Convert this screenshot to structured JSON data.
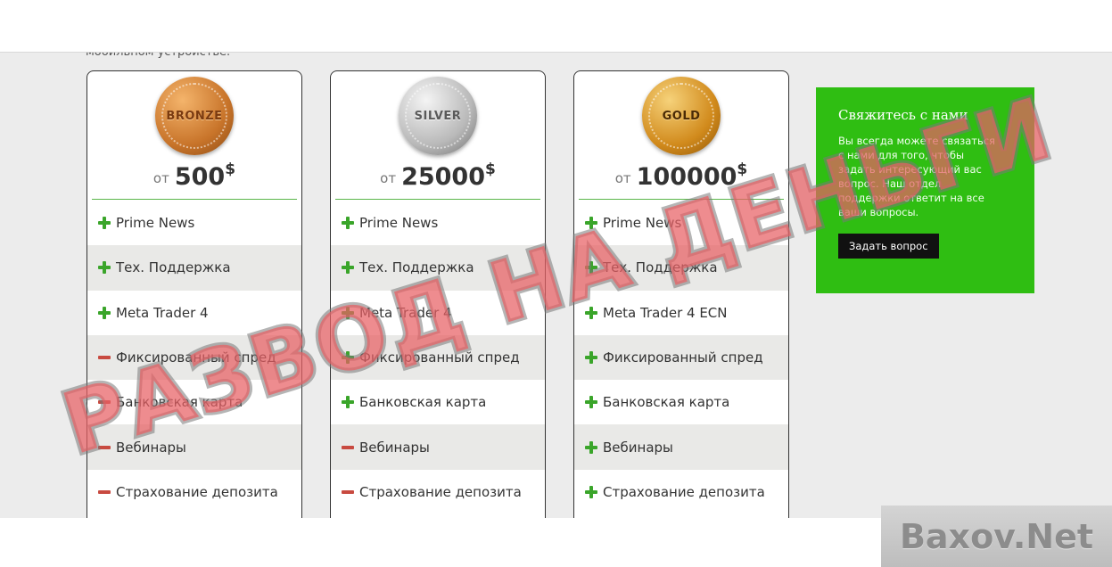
{
  "top_text": "мобильном устройстве.",
  "plans": [
    {
      "id": "bronze",
      "medal_label": "BRONZE",
      "price_prefix": "от",
      "price_amount": "500",
      "price_currency": "$",
      "features": [
        {
          "label": "Prime News",
          "included": true
        },
        {
          "label": "Тех. Поддержка",
          "included": true
        },
        {
          "label": "Meta Trader 4",
          "included": true
        },
        {
          "label": "Фиксированный спред",
          "included": false
        },
        {
          "label": "Банковская карта",
          "included": false
        },
        {
          "label": "Вебинары",
          "included": false
        },
        {
          "label": "Страхование депозита",
          "included": false
        }
      ]
    },
    {
      "id": "silver",
      "medal_label": "SILVER",
      "price_prefix": "от",
      "price_amount": "25000",
      "price_currency": "$",
      "features": [
        {
          "label": "Prime News",
          "included": true
        },
        {
          "label": "Тех. Поддержка",
          "included": true
        },
        {
          "label": "Meta Trader 4",
          "included": true
        },
        {
          "label": "Фиксированный спред",
          "included": true
        },
        {
          "label": "Банковская карта",
          "included": true
        },
        {
          "label": "Вебинары",
          "included": false
        },
        {
          "label": "Страхование депозита",
          "included": false
        }
      ]
    },
    {
      "id": "gold",
      "medal_label": "GOLD",
      "price_prefix": "от",
      "price_amount": "100000",
      "price_currency": "$",
      "features": [
        {
          "label": "Prime News",
          "included": true
        },
        {
          "label": "Тех. Поддержка",
          "included": true
        },
        {
          "label": "Meta Trader 4 ECN",
          "included": true
        },
        {
          "label": "Фиксированный спред",
          "included": true
        },
        {
          "label": "Банковская карта",
          "included": true
        },
        {
          "label": "Вебинары",
          "included": true
        },
        {
          "label": "Страхование депозита",
          "included": true
        }
      ]
    }
  ],
  "contact": {
    "title": "Свяжитесь с нами",
    "text": "Вы всегда можете связаться с нами для того, чтобы задать интересующий вас вопрос. Наш отдел поддержки ответит на все ваши вопросы.",
    "button_label": "Задать вопрос"
  },
  "stamp_text": "РАЗВОД НА ДЕНЬГИ",
  "watermark_text": "Baxov.Net",
  "colors": {
    "contact_bg": "#2fbe12",
    "plus": "#3aa52a",
    "minus": "#c84a40",
    "stamp": "#e85f64"
  }
}
